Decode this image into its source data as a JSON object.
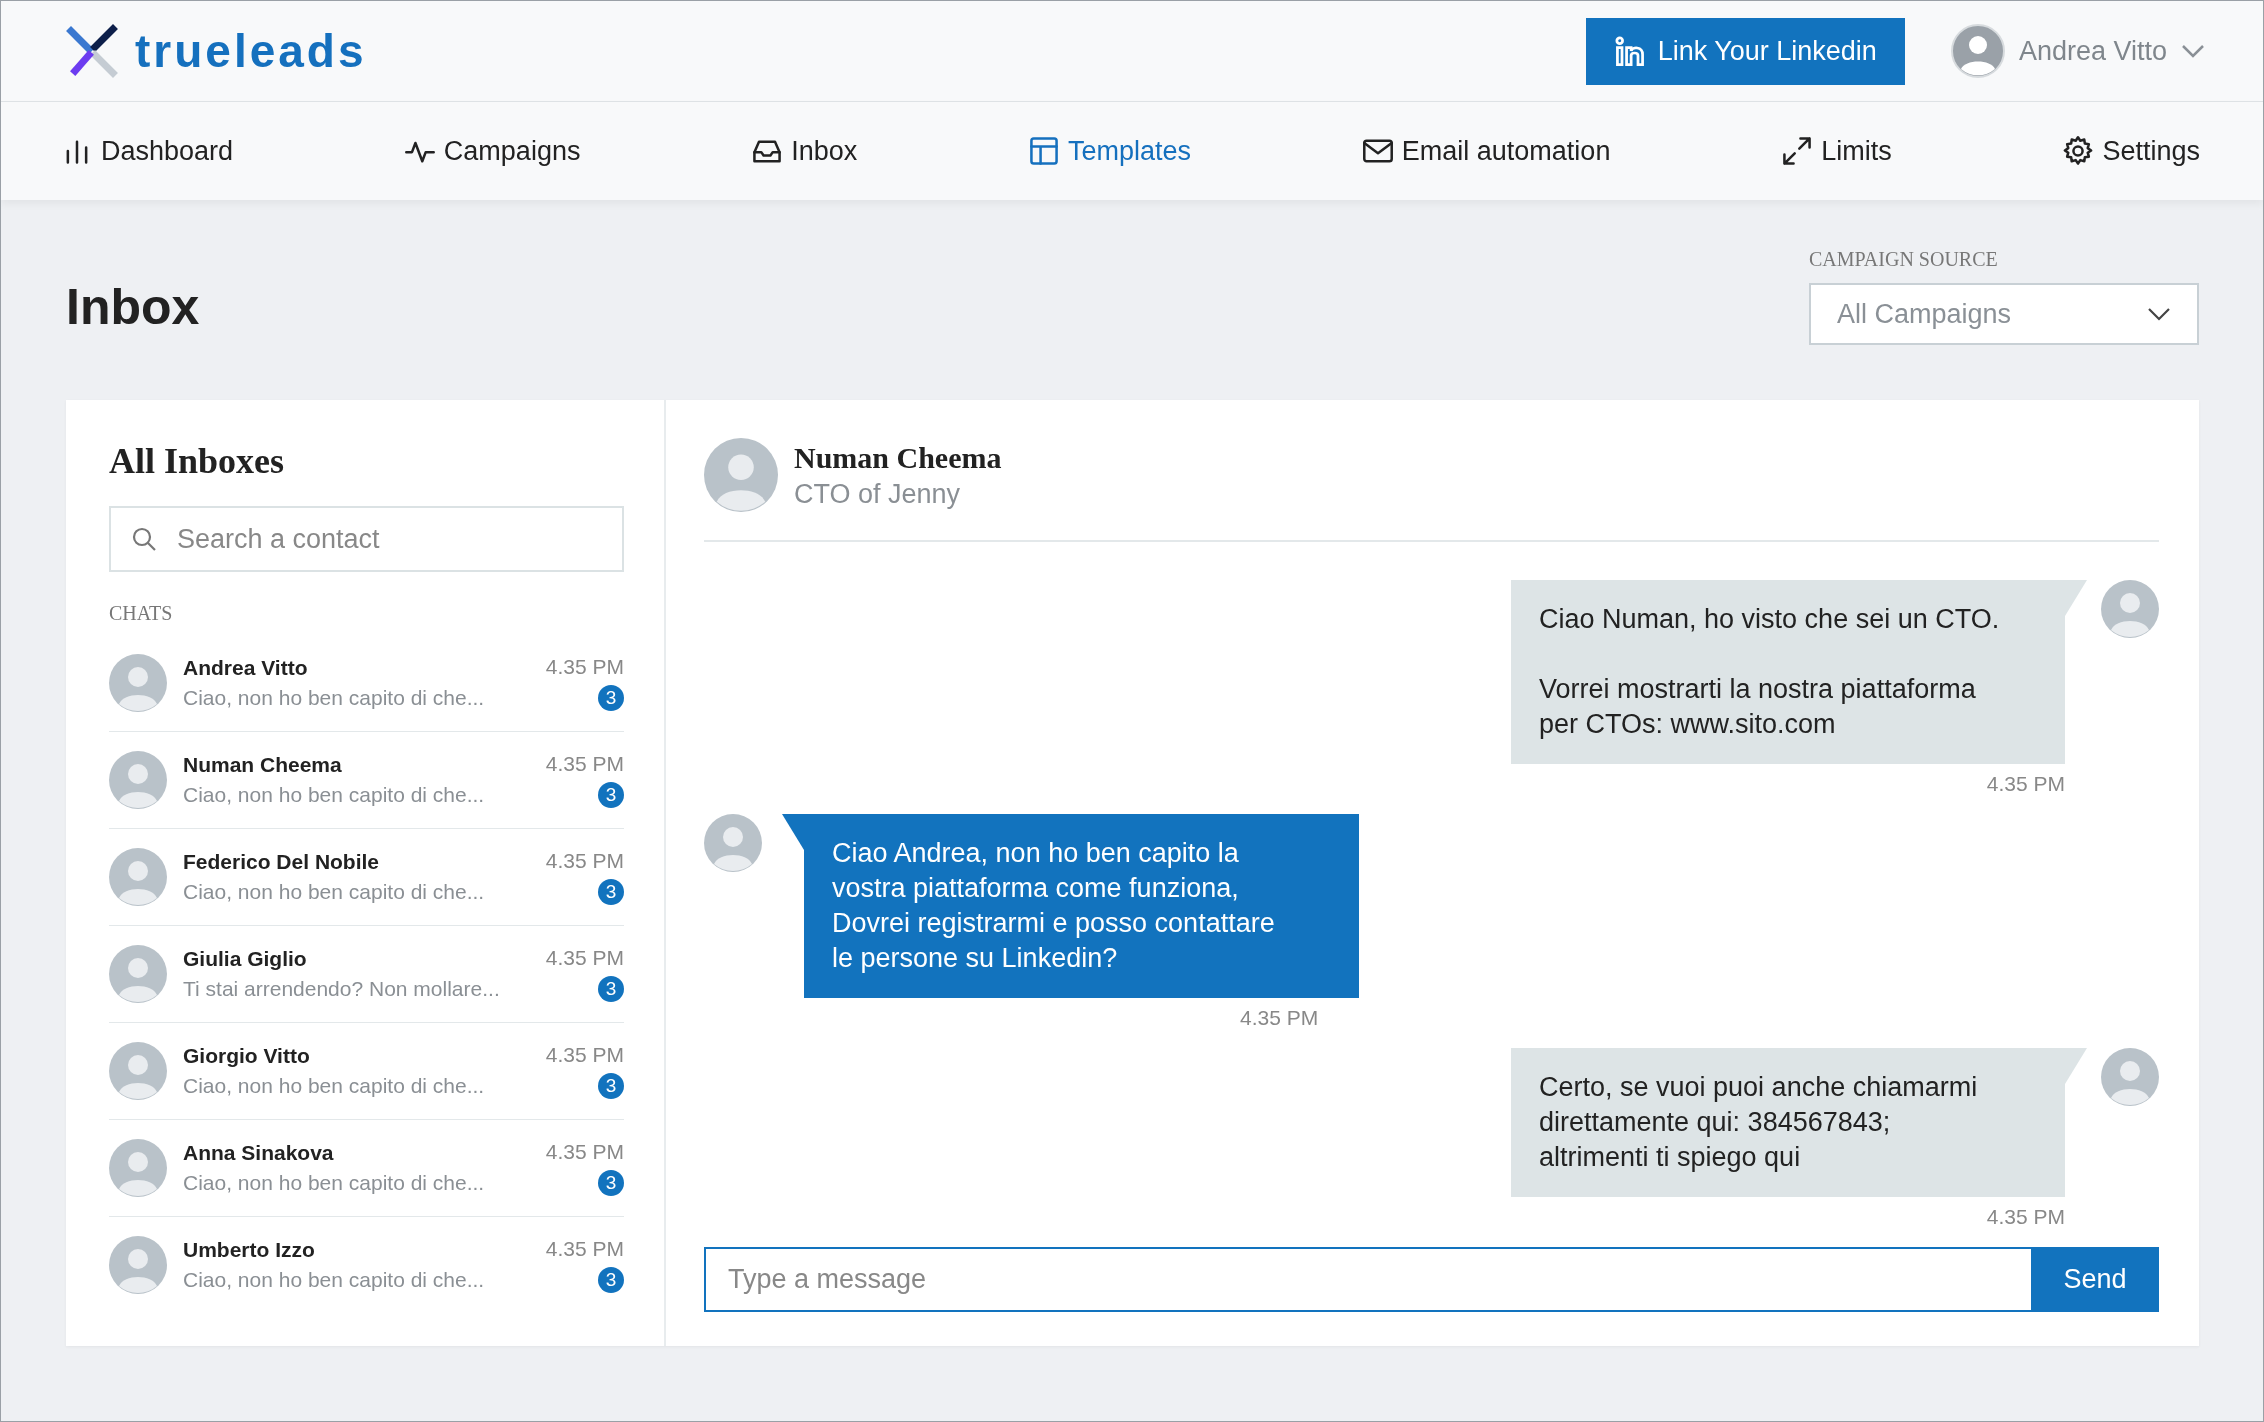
{
  "header": {
    "logo": "trueleads",
    "linkedin_button": "Link Your Linkedin",
    "user_name": "Andrea Vitto"
  },
  "nav": [
    {
      "label": "Dashboard",
      "selected": false
    },
    {
      "label": "Campaigns",
      "selected": false
    },
    {
      "label": "Inbox",
      "selected": false
    },
    {
      "label": "Templates",
      "selected": true
    },
    {
      "label": "Email automation",
      "selected": false
    },
    {
      "label": "Limits",
      "selected": false
    },
    {
      "label": "Settings",
      "selected": false
    }
  ],
  "page_title": "Inbox",
  "campaign_source": {
    "label": "CAMPAIGN SOURCE",
    "value": "All Campaigns"
  },
  "inboxes": {
    "title": "All Inboxes",
    "search": {
      "placeholder": "Search a contact"
    },
    "section": "CHATS",
    "chats": [
      {
        "name": "Andrea Vitto",
        "preview": "Ciao, non ho ben capito di che...",
        "time": "4.35 PM",
        "unread": "3"
      },
      {
        "name": "Numan Cheema",
        "preview": "Ciao, non ho ben capito di che...",
        "time": "4.35 PM",
        "unread": "3"
      },
      {
        "name": "Federico Del Nobile",
        "preview": "Ciao, non ho ben capito di che...",
        "time": "4.35 PM",
        "unread": "3"
      },
      {
        "name": "Giulia Giglio",
        "preview": "Ti stai arrendendo? Non mollare...",
        "time": "4.35 PM",
        "unread": "3"
      },
      {
        "name": "Giorgio Vitto",
        "preview": "Ciao, non ho ben capito di che...",
        "time": "4.35 PM",
        "unread": "3"
      },
      {
        "name": "Anna Sinakova",
        "preview": "Ciao, non ho ben capito di che...",
        "time": "4.35 PM",
        "unread": "3"
      },
      {
        "name": "Umberto Izzo",
        "preview": "Ciao, non ho ben capito di che...",
        "time": "4.35 PM",
        "unread": "3"
      }
    ]
  },
  "conversation": {
    "name": "Numan Cheema",
    "role": "CTO of Jenny",
    "messages": [
      {
        "kind": "sent",
        "text": "Ciao Numan, ho visto che sei un CTO.\n\nVorrei mostrarti la nostra piattaforma\nper CTOs: www.sito.com",
        "time": "4.35 PM"
      },
      {
        "kind": "received",
        "text": "Ciao Andrea, non ho ben capito la\nvostra piattaforma come funziona,\nDovrei registrarmi e posso contattare\nle persone su Linkedin?",
        "time": "4.35 PM"
      },
      {
        "kind": "sent",
        "text": "Certo, se vuoi puoi anche chiamarmi\ndirettamente qui: 384567843;\naltrimenti ti spiego qui",
        "time": "4.35 PM"
      }
    ],
    "composer": {
      "placeholder": "Type a message",
      "send": "Send"
    }
  }
}
